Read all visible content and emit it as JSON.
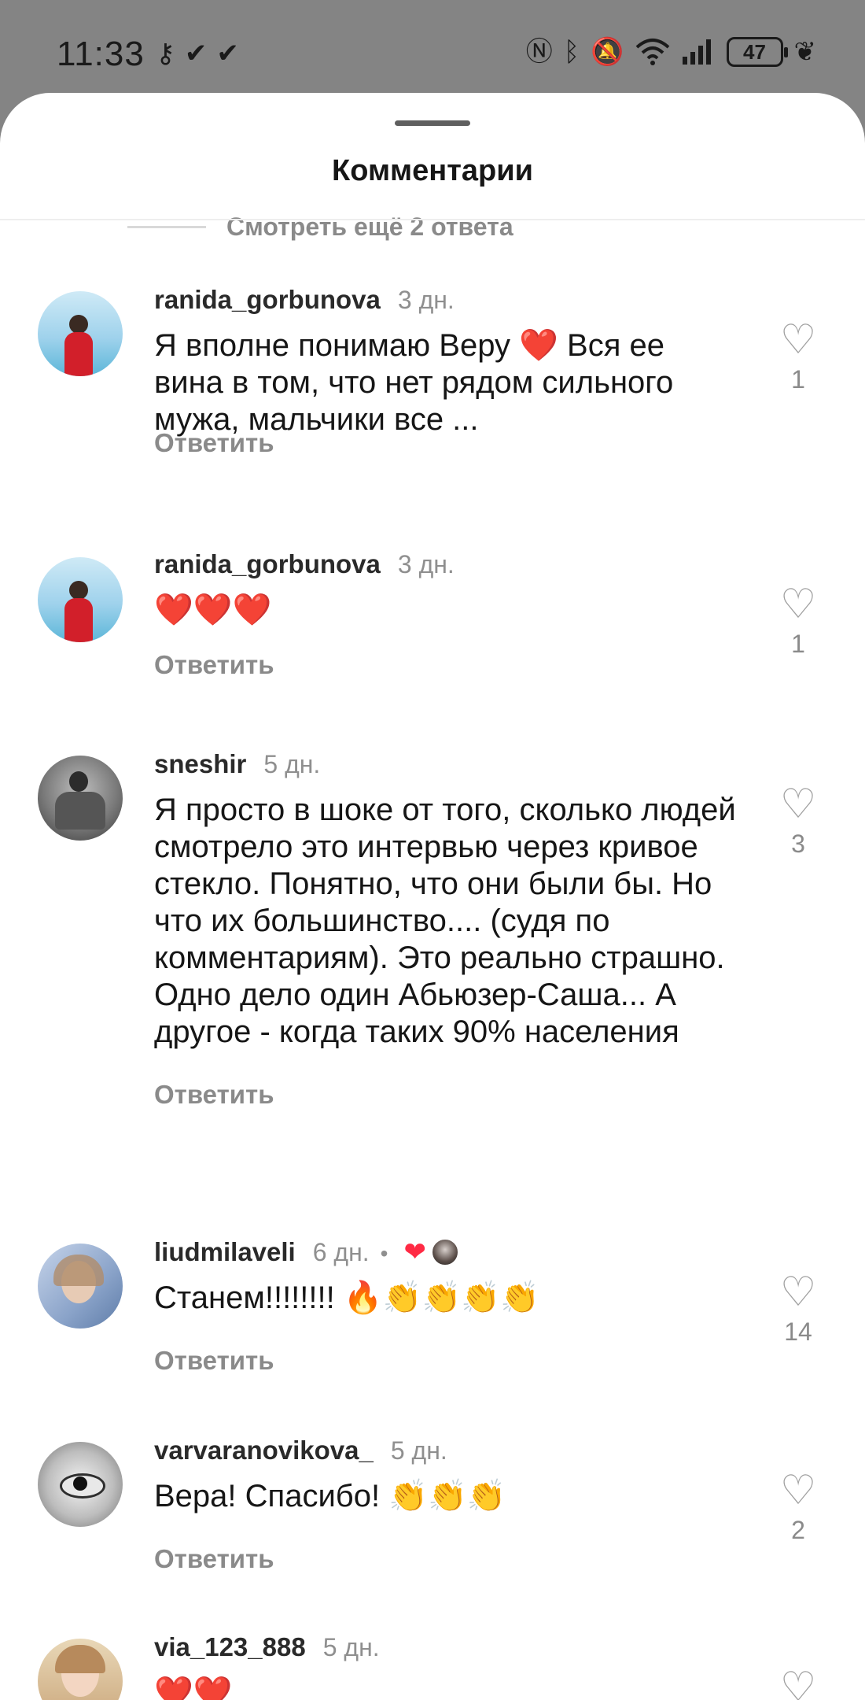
{
  "status_bar": {
    "time": "11:33",
    "left_icons": [
      "key-icon",
      "app-notification-icon",
      "app-notification-icon"
    ],
    "right_icons": [
      "nfc-icon",
      "bluetooth-icon",
      "mute-bell-icon",
      "wifi-icon",
      "signal-icon"
    ],
    "battery": "47"
  },
  "sheet": {
    "title": "Комментарии",
    "more_replies": "Смотреть ещё 2 ответа"
  },
  "comments": [
    {
      "username": "ranida_gorbunova",
      "time": "3 дн.",
      "text": "Я вполне понимаю Веру ❤️ Вся ее вина в том, что нет рядом сильного мужа, мальчики все ...",
      "reply_label": "Ответить",
      "likes": "1"
    },
    {
      "username": "ranida_gorbunova",
      "time": "3 дн.",
      "text": "❤️❤️❤️",
      "reply_label": "Ответить",
      "likes": "1"
    },
    {
      "username": "sneshir",
      "time": "5 дн.",
      "text": "Я просто в шоке от того, сколько людей смотрело это интервью через кривое стекло. Понятно, что они были бы. Но что их большинство.... (судя по комментариям). Это реально страшно. Одно дело один Абьюзер-Саша... А другое - когда таких 90% населения",
      "reply_label": "Ответить",
      "likes": "3"
    },
    {
      "username": "liudmilaveli",
      "time": "6 дн.",
      "separator": "•",
      "creator_liked": "❤",
      "text": "Станем!!!!!!!! 🔥👏👏👏👏",
      "reply_label": "Ответить",
      "likes": "14"
    },
    {
      "username": "varvaranovikova_",
      "time": "5 дн.",
      "text": "Вера! Спасибо! 👏👏👏",
      "reply_label": "Ответить",
      "likes": "2"
    },
    {
      "username": "via_123_888",
      "time": "5 дн.",
      "text": "❤️❤️"
    }
  ],
  "colors": {
    "background": "#ffffff",
    "overlay": "#848484",
    "text": "#161616",
    "secondary": "#8a8a8a",
    "heart": "#ff2a44"
  }
}
